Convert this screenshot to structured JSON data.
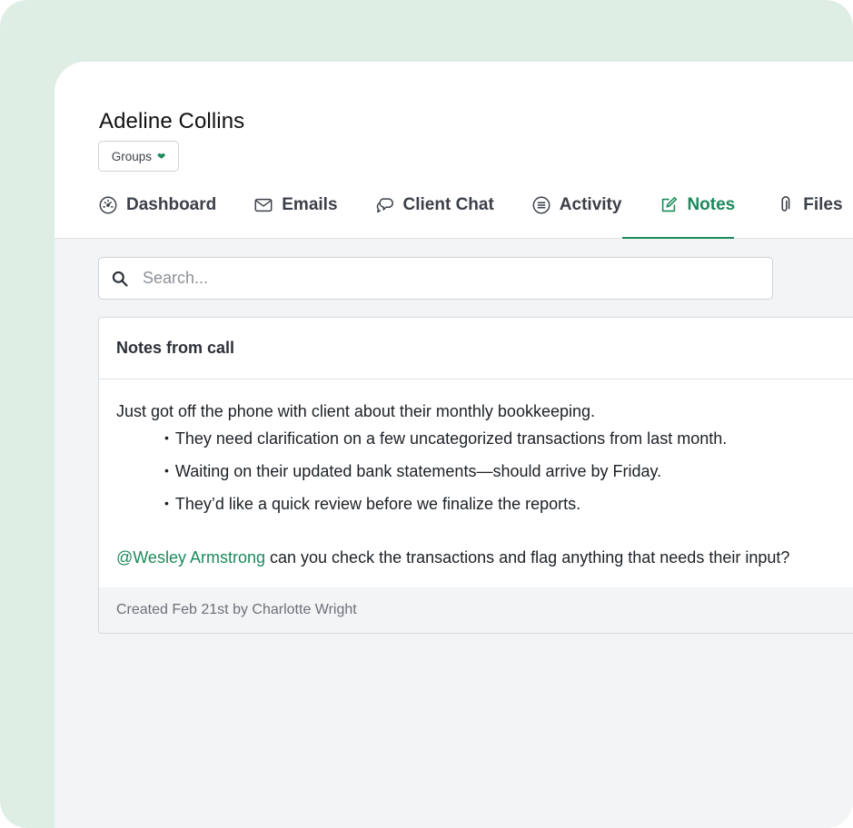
{
  "client": {
    "name": "Adeline Collins",
    "groups_label": "Groups"
  },
  "tabs": [
    {
      "label": "Dashboard",
      "icon": "gauge-icon"
    },
    {
      "label": "Emails",
      "icon": "envelope-icon"
    },
    {
      "label": "Client Chat",
      "icon": "chat-bubbles-icon"
    },
    {
      "label": "Activity",
      "icon": "list-icon"
    },
    {
      "label": "Notes",
      "icon": "edit-note-icon",
      "active": true
    },
    {
      "label": "Files",
      "icon": "paperclip-icon"
    }
  ],
  "search": {
    "placeholder": "Search..."
  },
  "note": {
    "title": "Notes from call",
    "intro": "Just got off the phone with client about their monthly bookkeeping.",
    "bullets": [
      "They need clarification on a few uncategorized transactions from last month.",
      "Waiting on their updated bank statements—should arrive by Friday.",
      "They’d like a quick review before we finalize the reports."
    ],
    "mention": "@Wesley Armstrong",
    "mention_text": " can you check the transactions and flag anything that needs their input?",
    "footer": "Created Feb 21st by Charlotte Wright"
  },
  "colors": {
    "accent": "#1b8a5a",
    "backdrop": "#dfeee4",
    "panel_bg": "#f3f4f6"
  }
}
